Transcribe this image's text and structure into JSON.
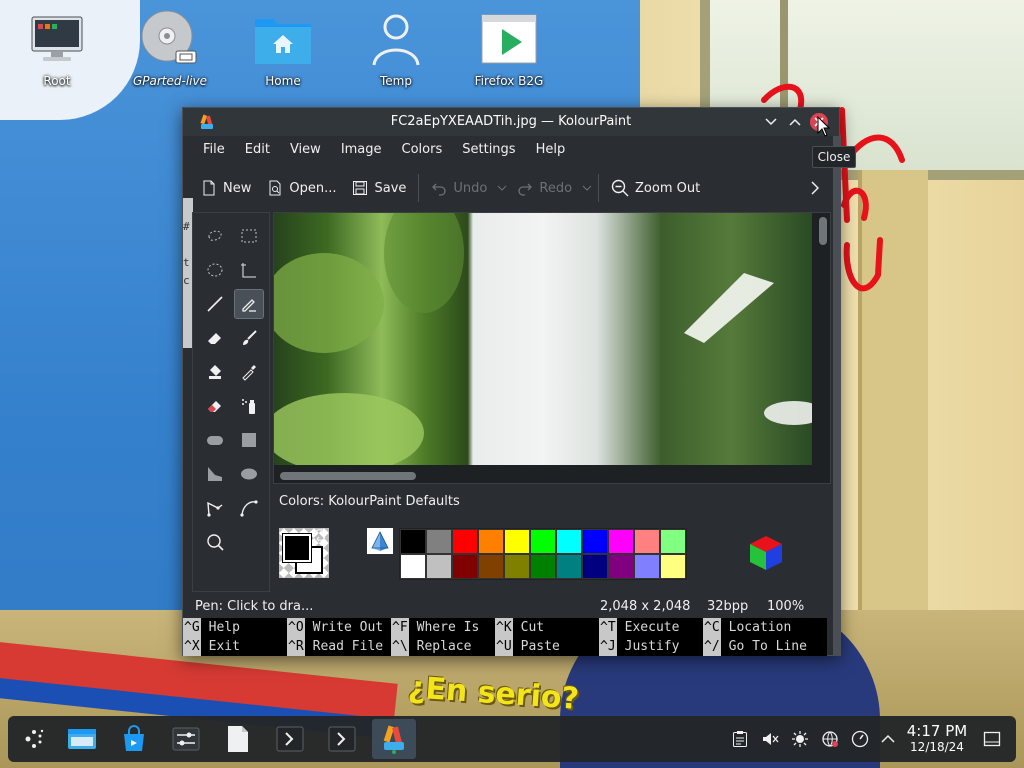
{
  "desktop": {
    "icons": [
      {
        "label": "Root"
      },
      {
        "label": "GParted-live"
      },
      {
        "label": "Home"
      },
      {
        "label": "Temp"
      },
      {
        "label": "Firefox B2G"
      }
    ],
    "subtitle_text": "¿En serio?"
  },
  "window": {
    "title": "FC2aEpYXEAADTih.jpg — KolourPaint",
    "close_tooltip": "Close",
    "menu": [
      "File",
      "Edit",
      "View",
      "Image",
      "Colors",
      "Settings",
      "Help"
    ],
    "toolbar": {
      "new": "New",
      "open": "Open...",
      "save": "Save",
      "undo": "Undo",
      "redo": "Redo",
      "zoom_out": "Zoom Out"
    },
    "colors_panel": {
      "title": "Colors: KolourPaint Defaults",
      "palette_row1": [
        "#000000",
        "#808080",
        "#ff0000",
        "#ff8000",
        "#ffff00",
        "#00ff00",
        "#00ffff",
        "#0000ff",
        "#ff00ff",
        "#ff8080",
        "#80ff80"
      ],
      "palette_row2": [
        "#ffffff",
        "#c0c0c0",
        "#800000",
        "#804000",
        "#808000",
        "#008000",
        "#008080",
        "#000080",
        "#800080",
        "#8080ff",
        "#ffff80"
      ]
    },
    "status": {
      "message": "Pen: Click to dra...",
      "dimensions": "2,048 x 2,048",
      "depth": "32bpp",
      "zoom": "100%"
    },
    "terminal_fragments": [
      "#",
      "t",
      "c"
    ]
  },
  "nano": {
    "row1": [
      {
        "key": "^G",
        "label": "Help"
      },
      {
        "key": "^O",
        "label": "Write Out"
      },
      {
        "key": "^F",
        "label": "Where Is"
      },
      {
        "key": "^K",
        "label": "Cut"
      },
      {
        "key": "^T",
        "label": "Execute"
      },
      {
        "key": "^C",
        "label": "Location"
      }
    ],
    "row2": [
      {
        "key": "^X",
        "label": "Exit"
      },
      {
        "key": "^R",
        "label": "Read File"
      },
      {
        "key": "^\\",
        "label": "Replace"
      },
      {
        "key": "^U",
        "label": "Paste"
      },
      {
        "key": "^J",
        "label": "Justify"
      },
      {
        "key": "^/",
        "label": "Go To Line"
      }
    ]
  },
  "taskbar": {
    "clock_time": "4:17 PM",
    "clock_date": "12/18/24"
  },
  "colors": {
    "window_bg": "#2a2e32",
    "titlebar_bg": "#31363b",
    "close_button": "#da4453",
    "taskbar_bg": "#232629"
  }
}
